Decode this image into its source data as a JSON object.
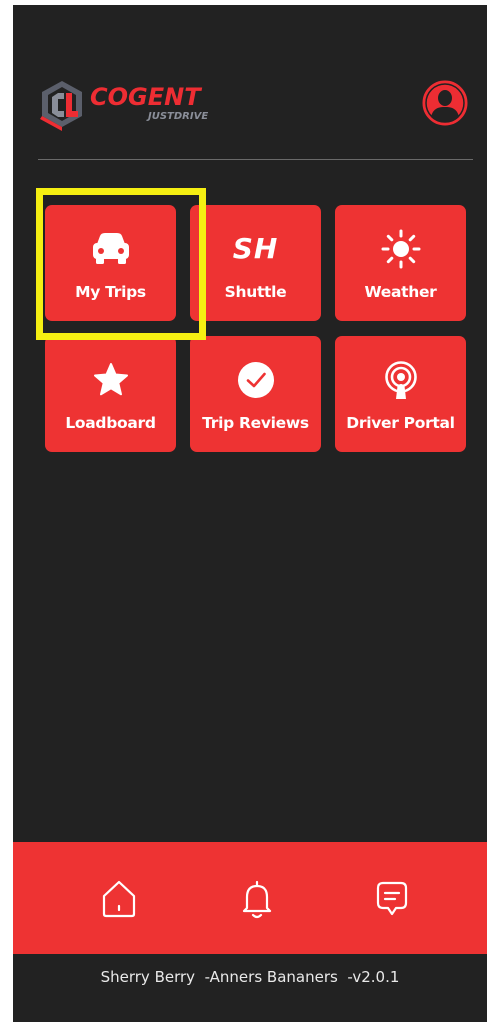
{
  "header": {
    "logo_word": "COGENT",
    "logo_sub": "JUSTDRIVE",
    "brand_color": "#ee2d33",
    "profile_icon": "user-icon"
  },
  "tiles": [
    {
      "label": "My Trips",
      "icon": "car-icon"
    },
    {
      "label": "Shuttle",
      "icon": "SH"
    },
    {
      "label": "Weather",
      "icon": "sun-icon"
    },
    {
      "label": "Loadboard",
      "icon": "star-icon"
    },
    {
      "label": "Trip Reviews",
      "icon": "check-circle-icon"
    },
    {
      "label": "Driver Portal",
      "icon": "broadcast-pin-icon"
    }
  ],
  "highlight": {
    "target": "My Trips",
    "color": "#f5ef12"
  },
  "bottom_nav": {
    "items": [
      {
        "icon": "home-icon"
      },
      {
        "icon": "bell-icon"
      },
      {
        "icon": "chat-icon"
      }
    ],
    "color": "#ee3333"
  },
  "footer": {
    "text": "Sherry Berry  -Anners Bananers  -v2.0.1"
  },
  "colors": {
    "background": "#222222",
    "accent": "#ee3333"
  }
}
